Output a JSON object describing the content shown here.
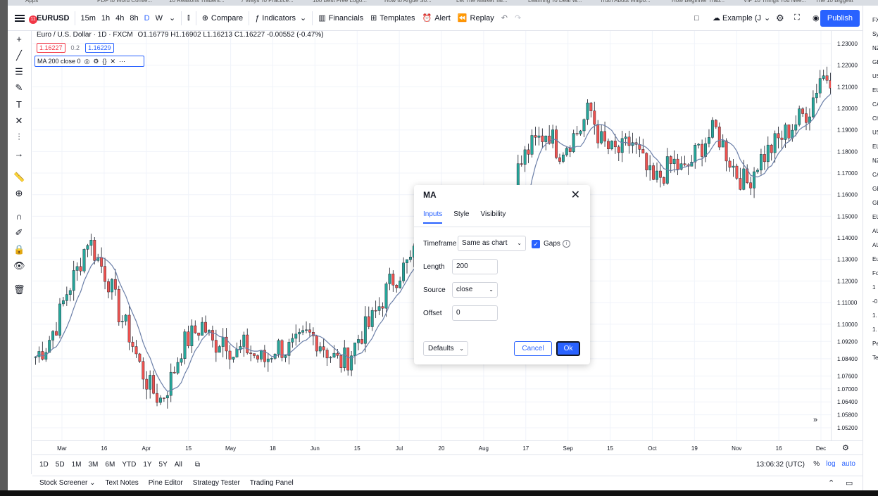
{
  "browser_tabs": [
    "Apps",
    "PDF to Word Conve...",
    "10 Reasons Traders...",
    "7 Ways To Practice...",
    "100 Best Free Logo...",
    "How to Argue So...",
    "Let The Market Tal...",
    "Learning To Deal W...",
    "Truth About Willpo...",
    "How Beginner Trad...",
    "VIP 10 Things You Nee...",
    "The 10 Biggest"
  ],
  "topbar": {
    "notification_count": "11",
    "symbol": "EURUSD",
    "timeframes": [
      "15m",
      "1h",
      "4h",
      "8h",
      "D",
      "W"
    ],
    "compare": "Compare",
    "indicators": "Indicators",
    "financials": "Financials",
    "templates": "Templates",
    "alert": "Alert",
    "replay": "Replay",
    "layout_name": "Example (J",
    "publish": "Publish"
  },
  "legend": {
    "name": "Euro / U.S. Dollar · 1D · FXCM",
    "ohlc": "O1.16779 H1.16902 L1.16213 C1.16227 -0.00552 (-0.47%)",
    "price_tags": [
      "1.16227",
      "0.2",
      "1.16229"
    ],
    "ma_label": "MA 200 close 0"
  },
  "chart_data": {
    "type": "candlestick",
    "ylim": [
      1.052,
      1.23
    ],
    "y_ticks": [
      "1.23000",
      "1.22000",
      "1.21000",
      "1.20000",
      "1.19000",
      "1.18000",
      "1.17000",
      "1.16000",
      "1.15000",
      "1.14000",
      "1.13000",
      "1.12000",
      "1.11000",
      "1.10000",
      "1.09200",
      "1.08400",
      "1.07600",
      "1.07000",
      "1.06400",
      "1.05800",
      "1.05200"
    ],
    "x_ticks": [
      "Mar",
      "16",
      "Apr",
      "15",
      "May",
      "18",
      "Jun",
      "15",
      "Jul",
      "20",
      "Aug",
      "17",
      "Sep",
      "15",
      "Oct",
      "19",
      "Nov",
      "16",
      "Dec"
    ],
    "close_path": [
      1.085,
      1.09,
      1.1,
      1.115,
      1.125,
      1.14,
      1.13,
      1.12,
      1.105,
      1.095,
      1.08,
      1.07,
      1.065,
      1.075,
      1.09,
      1.095,
      1.1,
      1.09,
      1.095,
      1.085,
      1.09,
      1.085,
      1.083,
      1.09,
      1.088,
      1.09,
      1.095,
      1.093,
      1.087,
      1.082,
      1.085,
      1.095,
      1.1,
      1.11,
      1.12,
      1.125,
      1.13,
      1.14,
      1.135,
      1.13,
      1.125,
      1.12,
      1.125,
      1.128,
      1.127,
      1.13,
      1.17,
      1.18,
      1.185,
      1.19,
      1.18,
      1.185,
      1.19,
      1.2,
      1.185,
      1.18,
      1.18,
      1.185,
      1.175,
      1.165,
      1.17,
      1.175,
      1.17,
      1.178,
      1.185,
      1.19,
      1.18,
      1.17,
      1.165,
      1.175,
      1.18,
      1.185,
      1.19,
      1.195,
      1.2,
      1.215,
      1.215
    ]
  },
  "dialog": {
    "title": "MA",
    "tabs": [
      "Inputs",
      "Style",
      "Visibility"
    ],
    "timeframe_label": "Timeframe",
    "timeframe_value": "Same as chart",
    "gaps_label": "Gaps",
    "length_label": "Length",
    "length_value": "200",
    "source_label": "Source",
    "source_value": "close",
    "offset_label": "Offset",
    "offset_value": "0",
    "defaults": "Defaults",
    "cancel": "Cancel",
    "ok": "Ok"
  },
  "range_bar": {
    "ranges": [
      "1D",
      "5D",
      "1M",
      "3M",
      "6M",
      "YTD",
      "1Y",
      "5Y",
      "All"
    ],
    "clock": "13:06:32 (UTC)",
    "percent": "%",
    "log": "log",
    "auto": "auto"
  },
  "bottom_tabs": [
    "Stock Screener",
    "Text Notes",
    "Pine Editor",
    "Strategy Tester",
    "Trading Panel"
  ],
  "right_panel": [
    "FX",
    "Sy",
    "NZ",
    "GB",
    "US",
    "EU",
    "CA",
    "CH",
    "US",
    "EU",
    "NZ",
    "CA",
    "GB",
    "GB",
    "EU",
    "AU",
    "AU",
    "Eu",
    "Fo",
    "1",
    "-0",
    "1.",
    "1.",
    "Pe",
    "Te"
  ]
}
